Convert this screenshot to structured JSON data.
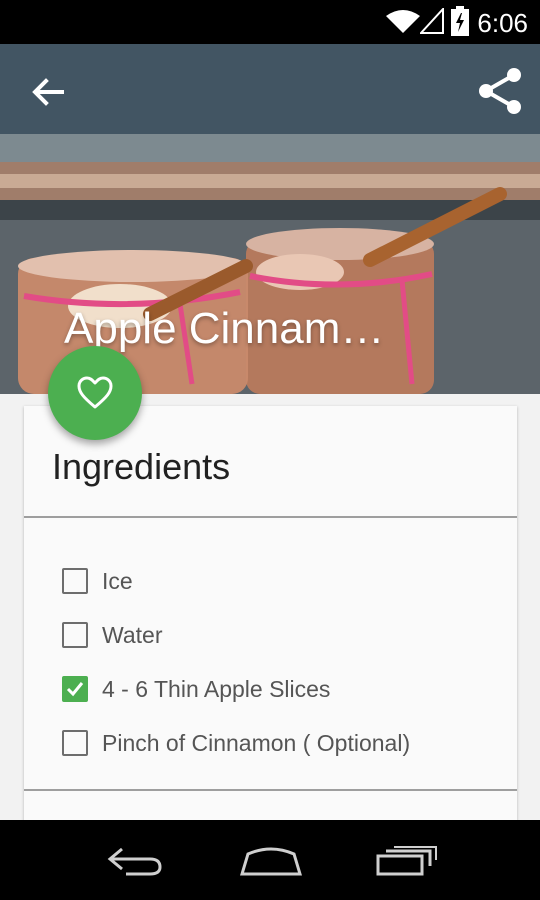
{
  "status_bar": {
    "time": "6:06",
    "icons": [
      "wifi-icon",
      "signal-icon",
      "battery-charging-icon"
    ]
  },
  "app_bar": {
    "back_icon": "arrow-left-icon",
    "share_icon": "share-icon"
  },
  "recipe": {
    "title": "Apple Cinnam…"
  },
  "fab": {
    "icon": "heart-outline-icon",
    "color": "#4caf50"
  },
  "ingredients_card": {
    "heading": "Ingredients",
    "items": [
      {
        "label": "Ice",
        "checked": false
      },
      {
        "label": "Water",
        "checked": false
      },
      {
        "label": "4 - 6 Thin Apple Slices",
        "checked": true
      },
      {
        "label": "Pinch of Cinnamon ( Optional)",
        "checked": false
      }
    ]
  },
  "nav_bar": {
    "icons": [
      "back-nav-icon",
      "home-nav-icon",
      "recents-nav-icon"
    ]
  }
}
